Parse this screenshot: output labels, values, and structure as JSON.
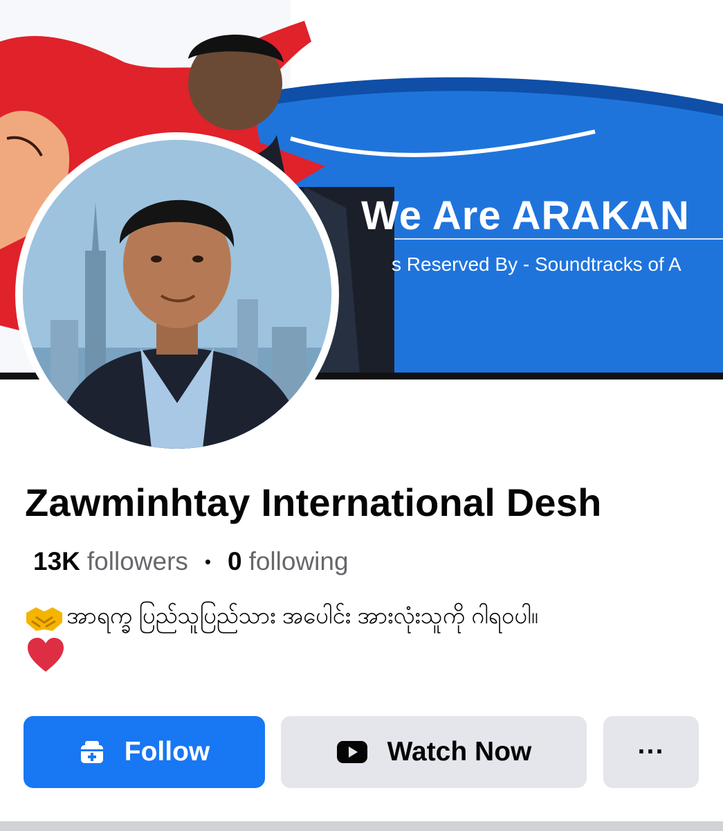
{
  "cover": {
    "title": "We Are ARAKAN",
    "subtitle": "s Reserved By - Soundtracks of A"
  },
  "profile": {
    "name": "Zawminhtay International Desh",
    "followers_count": "13K",
    "followers_label": "followers",
    "following_count": "0",
    "following_label": "following",
    "bio_text": "အာရက္ခ ပြည်သူပြည်သား အပေါင်း အားလုံးသူကို ဂါရဝပါ။"
  },
  "actions": {
    "follow_label": "Follow",
    "watch_label": "Watch Now",
    "more_label": "···"
  },
  "icons": {
    "bio_emoji": "handshake-icon",
    "heart": "heart-icon",
    "follow": "follow-icon",
    "watch": "play-icon"
  },
  "colors": {
    "brand_blue": "#1877f2",
    "button_gray": "#e4e6eb",
    "cover_blue": "#1f74dc",
    "cover_red": "#e0222a"
  }
}
